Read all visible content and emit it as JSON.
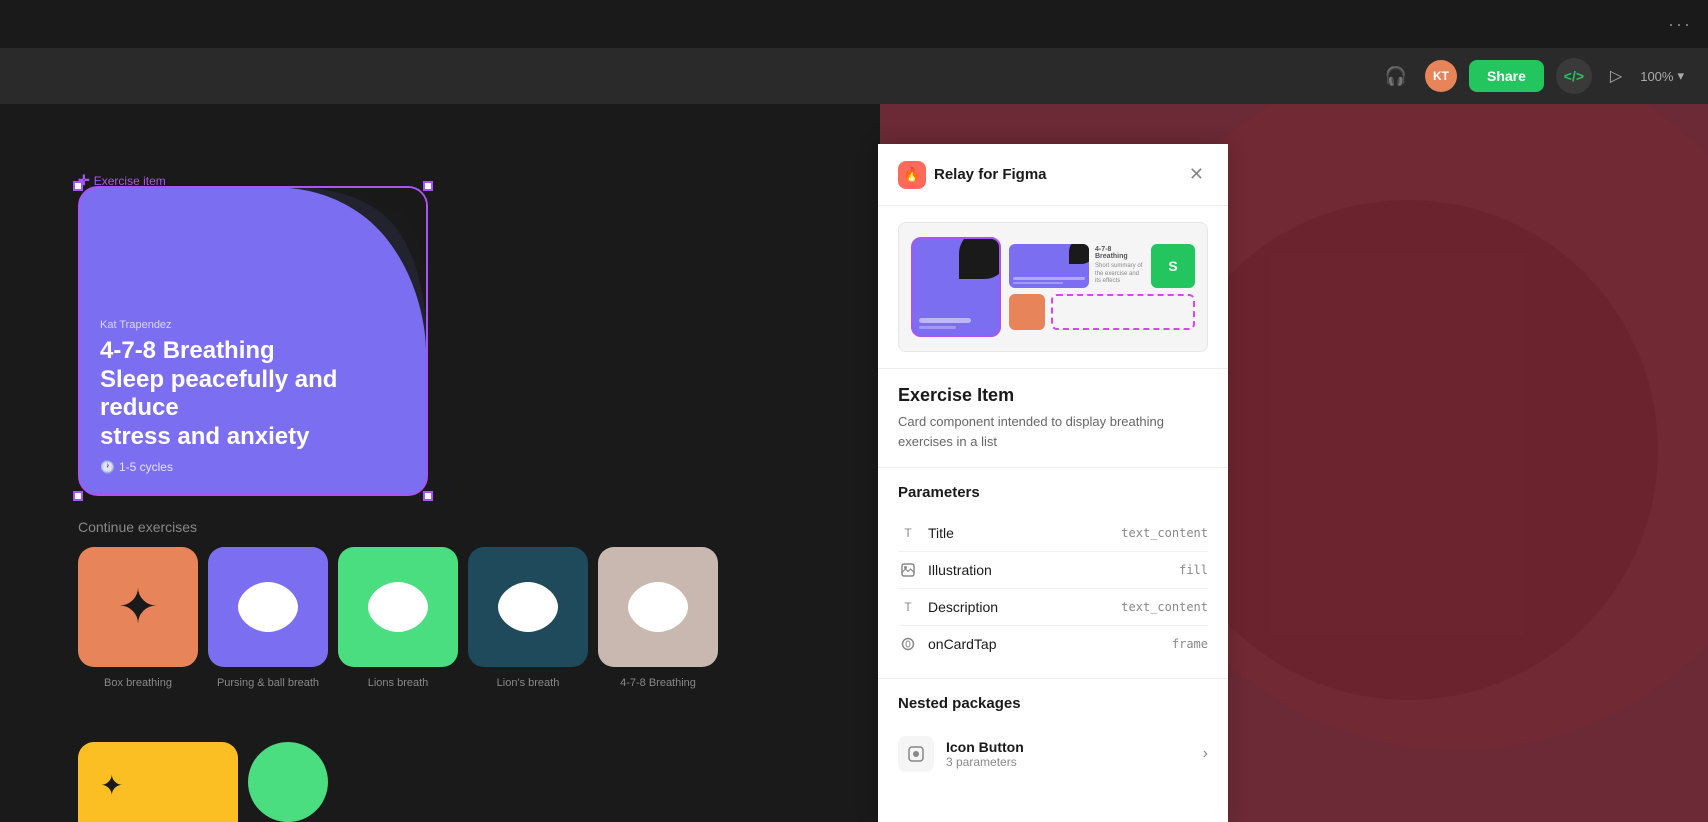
{
  "topbar": {
    "dots": "···"
  },
  "toolbar": {
    "share_label": "Share",
    "code_label": "</>",
    "zoom_label": "100%",
    "zoom_arrow": "▾"
  },
  "canvas": {
    "exercise_label": "Exercise item",
    "card": {
      "author": "Kat Trapendez",
      "title": "4-7-8 Breathing\nSleep peacefully and reduce stress and anxiety",
      "title_line1": "4-7-8 Breathing",
      "title_line2": "Sleep peacefully and reduce",
      "title_line3": "stress and anxiety",
      "cycles": "1-5 cycles"
    },
    "continue_title": "Continue exercises",
    "exercise_items": [
      {
        "label": "Box breathing",
        "color": "#e8845a"
      },
      {
        "label": "Pursing & ball breath",
        "color": "#7c6ef0"
      },
      {
        "label": "Lions breath",
        "color": "#4ade80"
      },
      {
        "label": "Lion's breath",
        "color": "#1e4a5c"
      },
      {
        "label": "4-7-8 Breathing",
        "color": "#c9b8b0"
      }
    ]
  },
  "relay_panel": {
    "title": "Relay for Figma",
    "component_name": "Exercise Item",
    "component_desc": "Card component intended to display breathing exercises in a list",
    "parameters_title": "Parameters",
    "params": [
      {
        "icon": "T",
        "name": "Title",
        "type": "text_content"
      },
      {
        "icon": "img",
        "name": "Illustration",
        "type": "fill"
      },
      {
        "icon": "T",
        "name": "Description",
        "type": "text_content"
      },
      {
        "icon": "link",
        "name": "onCardTap",
        "type": "frame"
      }
    ],
    "nested_title": "Nested packages",
    "nested_items": [
      {
        "name": "Icon Button",
        "params": "3 parameters"
      }
    ]
  }
}
